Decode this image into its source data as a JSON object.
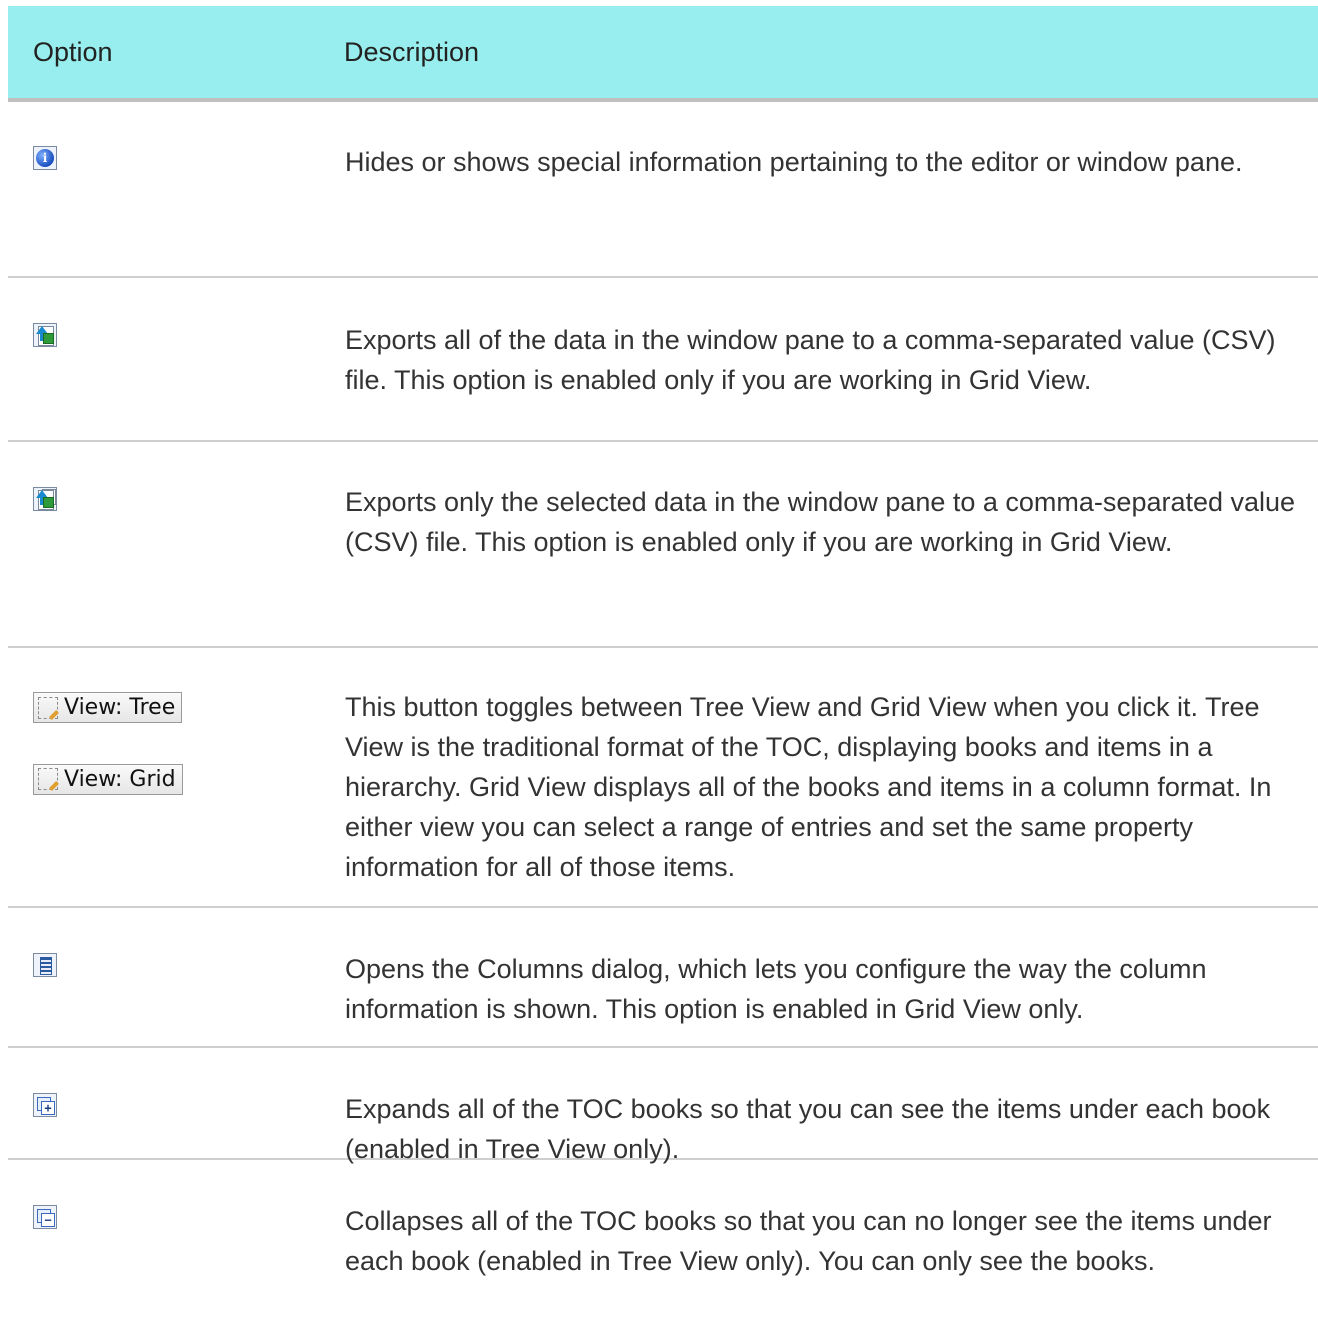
{
  "table": {
    "header": {
      "option": "Option",
      "description": "Description"
    },
    "rows": [
      {
        "icon": "info-icon",
        "description": "Hides or shows special information pertaining to the editor or window pane."
      },
      {
        "icon": "export-all-csv-icon",
        "description": "Exports all of the data in the window pane to a comma-separated value (CSV) file. This option is enabled only if you are working in Grid View."
      },
      {
        "icon": "export-selected-csv-icon",
        "description": "Exports only the selected data in the window pane to a comma-separated value (CSV) file. This option is enabled only if you are working in Grid View."
      },
      {
        "icon": "view-toggle-icon",
        "buttons": [
          "View: Tree",
          "View: Grid"
        ],
        "description": "This button toggles between Tree View and Grid View when you click it. Tree View is the traditional format of the TOC, displaying books and items in a hierarchy. Grid View displays all of the books and items in a column format. In either view you can select a range of entries and set the same property information for all of those items."
      },
      {
        "icon": "columns-icon",
        "description": "Opens the Columns dialog, which lets you configure the way the column information is shown. This option is enabled in Grid View only."
      },
      {
        "icon": "expand-all-icon",
        "description": "Expands all of the TOC books so that you can see the items under each book (enabled in Tree View only)."
      },
      {
        "icon": "collapse-all-icon",
        "description": "Collapses all of the TOC books so that you can no longer see the items under each book (enabled in Tree View only). You can only see the books."
      }
    ]
  }
}
